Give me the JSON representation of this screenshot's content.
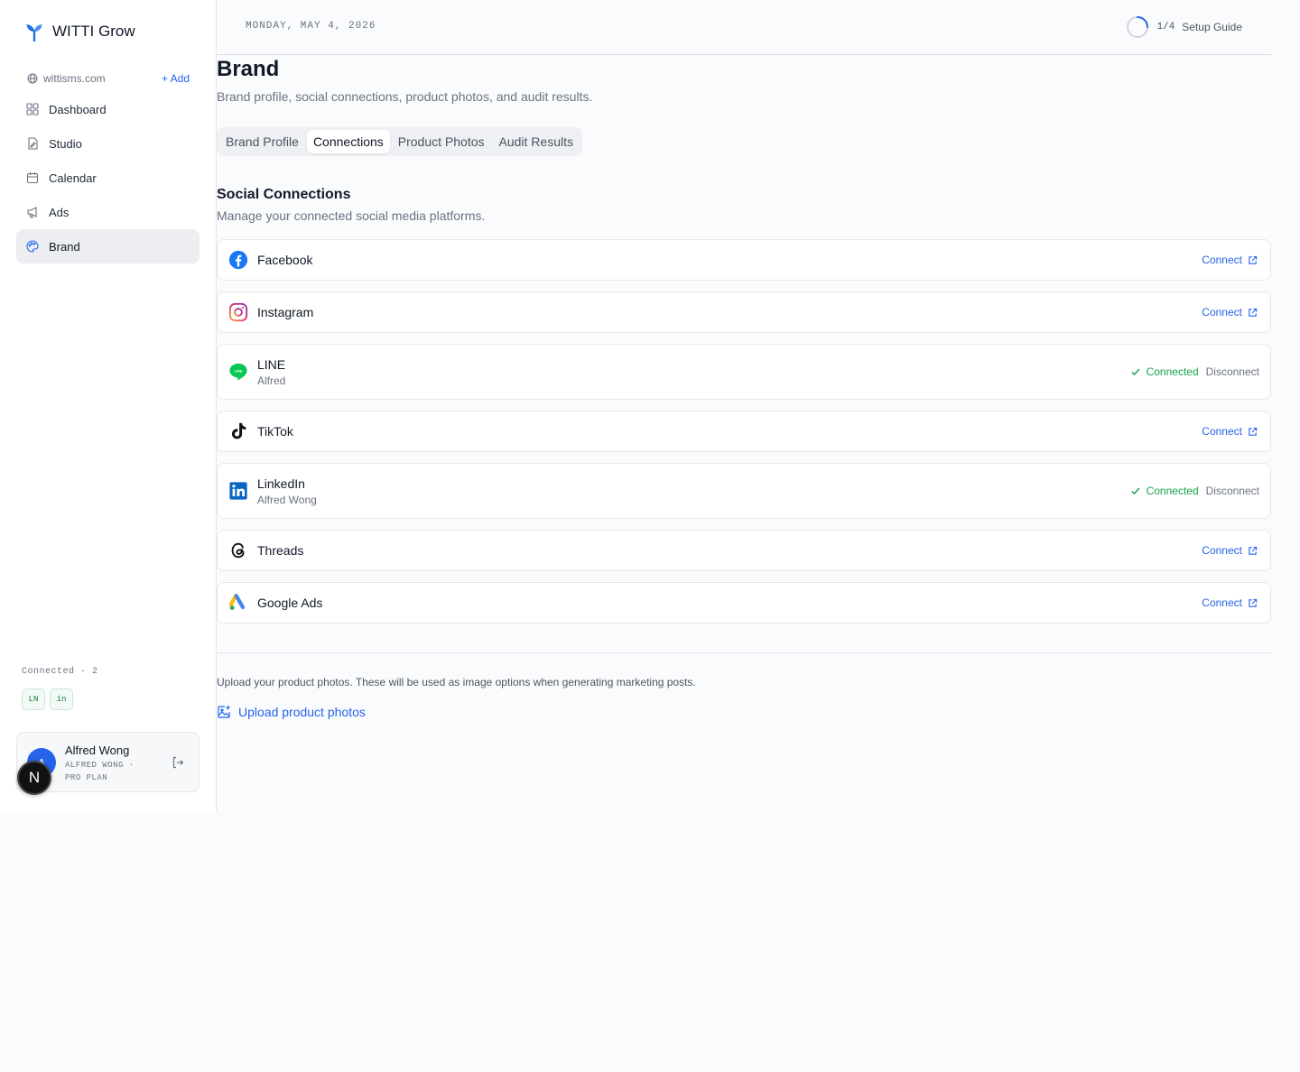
{
  "app": {
    "name": "WITTI Grow"
  },
  "sidebar": {
    "domain": "wittisms.com",
    "add_label": "+ Add",
    "items": [
      {
        "label": "Dashboard",
        "icon": "dashboard-icon"
      },
      {
        "label": "Studio",
        "icon": "studio-icon"
      },
      {
        "label": "Calendar",
        "icon": "calendar-icon"
      },
      {
        "label": "Ads",
        "icon": "megaphone-icon"
      },
      {
        "label": "Brand",
        "icon": "palette-icon",
        "active": true
      }
    ],
    "connected_label": "Connected · 2",
    "connected_badges": [
      "LN",
      "in"
    ]
  },
  "user": {
    "initial": "A",
    "name": "Alfred Wong",
    "sub": "ALFRED WONG · PRO PLAN"
  },
  "dev_badge": "N",
  "topbar": {
    "date": "MONDAY, MAY 4, 2026",
    "setup_count": "1/4",
    "setup_label": "Setup Guide"
  },
  "page": {
    "title": "Brand",
    "subtitle": "Brand profile, social connections, product photos, and audit results.",
    "tabs": [
      "Brand Profile",
      "Connections",
      "Product Photos",
      "Audit Results"
    ],
    "active_tab": "Connections"
  },
  "connections": {
    "title": "Social Connections",
    "subtitle": "Manage your connected social media platforms.",
    "connect_label": "Connect",
    "connected_label": "Connected",
    "disconnect_label": "Disconnect",
    "platforms": [
      {
        "name": "Facebook",
        "status": "disconnected"
      },
      {
        "name": "Instagram",
        "status": "disconnected"
      },
      {
        "name": "LINE",
        "status": "connected",
        "account": "Alfred"
      },
      {
        "name": "TikTok",
        "status": "disconnected"
      },
      {
        "name": "LinkedIn",
        "status": "connected",
        "account": "Alfred Wong"
      },
      {
        "name": "Threads",
        "status": "disconnected"
      },
      {
        "name": "Google Ads",
        "status": "disconnected"
      }
    ]
  },
  "photos": {
    "description": "Upload your product photos. These will be used as image options when generating marketing posts.",
    "upload_label": "Upload product photos"
  },
  "colors": {
    "accent": "#2563eb",
    "success": "#16a34a",
    "facebook": "#1877F2",
    "line": "#06C755",
    "linkedin": "#0A66C2"
  }
}
